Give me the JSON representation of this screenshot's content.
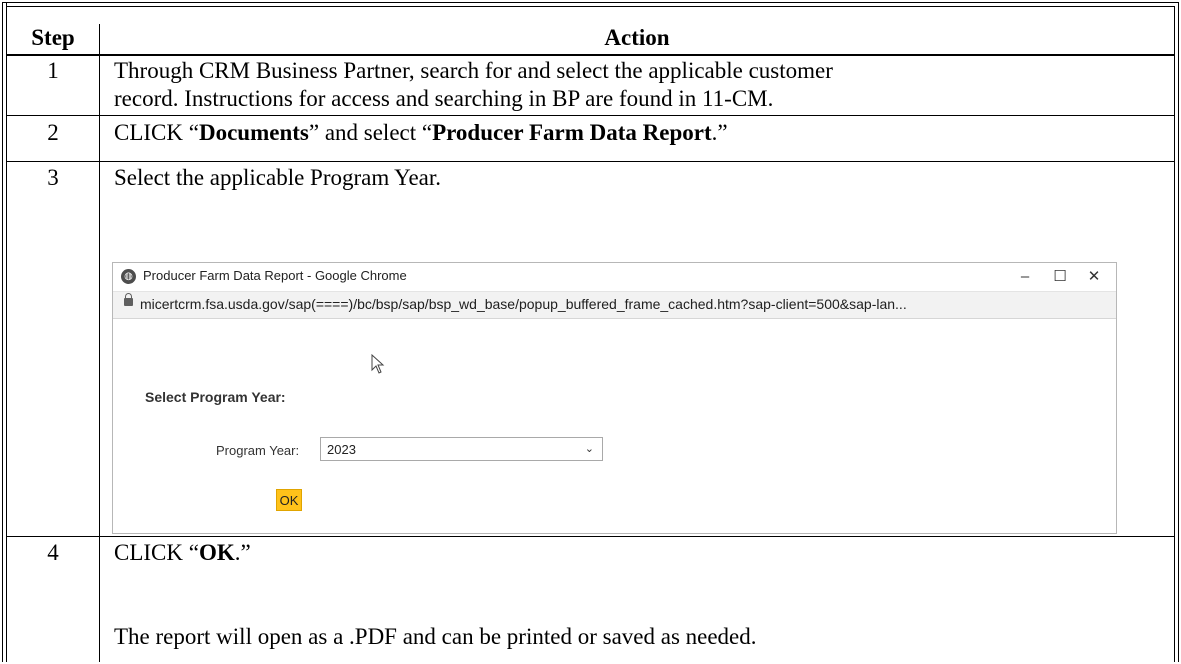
{
  "table": {
    "headers": {
      "step": "Step",
      "action": "Action"
    },
    "rows": [
      {
        "step": "1",
        "line1": "Through CRM Business Partner, search for and select the applicable customer",
        "line2": "record.  Instructions for access and searching in BP are found in 11-CM."
      },
      {
        "step": "2",
        "pre": "CLICK “",
        "b1": "Documents",
        "mid": "” and select “",
        "b2": "Producer Farm Data Report",
        "post": ".”"
      },
      {
        "step": "3",
        "text": "Select the applicable Program Year."
      },
      {
        "step": "4",
        "pre": "CLICK “",
        "b1": "OK",
        "post": ".”",
        "note": "The report will open as a .PDF and can be printed or saved as needed."
      }
    ]
  },
  "popup": {
    "window_title": "Producer Farm Data Report - Google Chrome",
    "url": "micertcrm.fsa.usda.gov/sap(====)/bc/bsp/sap/bsp_wd_base/popup_buffered_frame_cached.htm?sap-client=500&sap-lan...",
    "minimize": "–",
    "maximize": "☐",
    "close": "✕",
    "heading": "Select Program Year:",
    "program_year_label": "Program Year:",
    "program_year_value": "2023",
    "ok_label": "OK",
    "accent_color": "#ffc21a"
  }
}
